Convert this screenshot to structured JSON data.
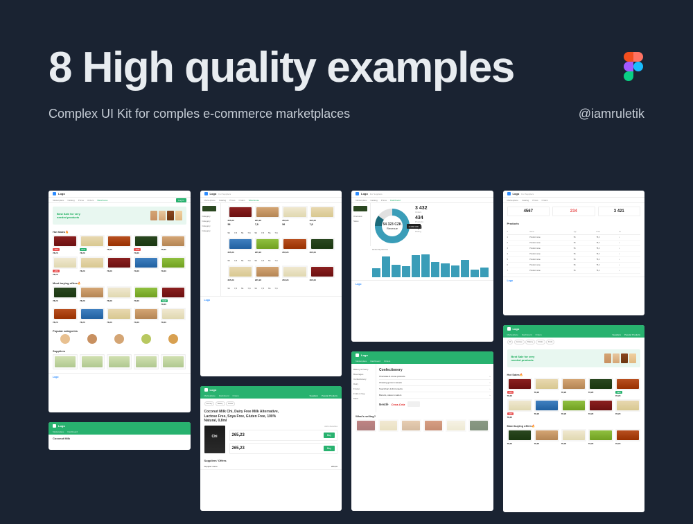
{
  "title": "8 High quality examples",
  "subtitle": "Complex UI Kit for comples e-commerce marketplaces",
  "handle": "@iamruletik",
  "common": {
    "logo": "Logo",
    "for_suppliers": "For Suppliers",
    "hero_text": "Best Sale for very needed products",
    "hot_sales": "Hot Sales",
    "most_buying": "Most buying offers",
    "popular_categories": "Popular categories",
    "suppliers": "Suppliers",
    "suppliers_offers": "Suppliers' Offers",
    "products": "Products",
    "fire": "🔥"
  },
  "nav": [
    "Marketplace",
    "Catalog",
    "Prices",
    "Orders",
    "Warehouse",
    "Dashboard",
    "Suppliers",
    "Popular Products"
  ],
  "screens": {
    "dashboard": {
      "donut_value": "54 323 CZK",
      "donut_label": "Revenue",
      "tooltip": "2 449 CZK",
      "stat1": "3 432",
      "stat2": "434",
      "stat3": "6,8",
      "chart_section": "Order Dynamics"
    },
    "admin": {
      "m1": "4567",
      "m2": "234",
      "m3": "3 421"
    },
    "catalog": {
      "title": "Confectionery",
      "brands_nestle": "Nestlé",
      "brands_coca": "Coca-Cola",
      "what_selling": "What's selling?"
    },
    "detail": {
      "title": "Coconut Milk Chi, Dairy Free Milk Alternative, Lactose Free, Soya Free, Gluten Free, 100% Natural, 0,8ml",
      "add_favorites": "Add to favourites",
      "price": "265,23"
    }
  },
  "scores": [
    "56",
    "7,8",
    "56",
    "7,8",
    "56",
    "7,8",
    "56",
    "7,8"
  ],
  "chart_data": {
    "type": "bar",
    "title": "Order Dynamics",
    "values": [
      35,
      82,
      50,
      45,
      88,
      92,
      62,
      55,
      48,
      70,
      30,
      38
    ]
  }
}
